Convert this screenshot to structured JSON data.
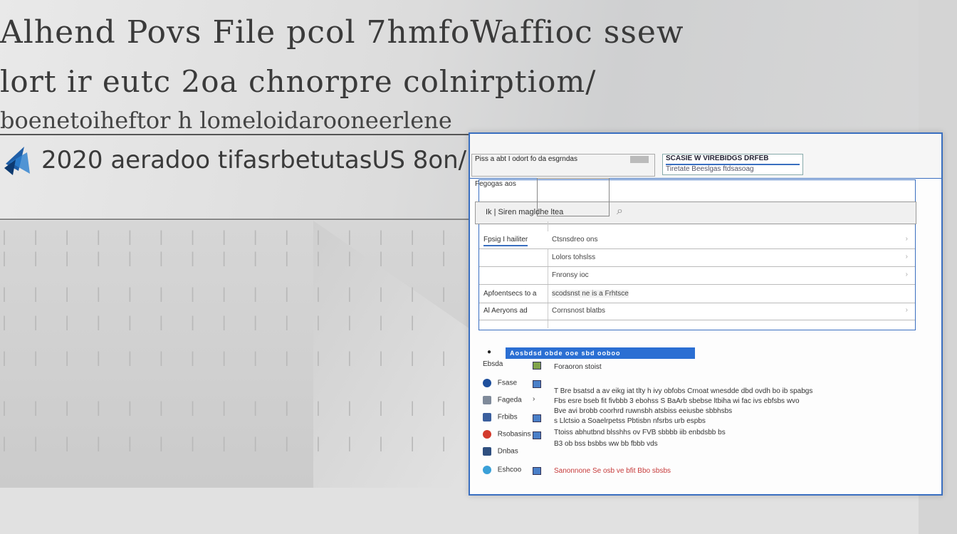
{
  "hero": {
    "line1": "Alhend Povs File pcol 7hmfoWaffioc ssew",
    "line2": "lort ir eutc 2oa chnorpre colnirptiom/",
    "line3": "boenetoiheftor h lomeloidarooneerlene",
    "line4": "2020 aeradoo tifasrbetutasUS 8on/"
  },
  "window": {
    "breadcrumb": {
      "text": "Piss a abt I odort fo da esgrndas"
    },
    "tab": {
      "title": "SCASIE W VIREBIDGS DRFEB",
      "subtitle": "Tiretate Beeslgas ftdsasoag"
    },
    "panel": {
      "title": "Fegogas aos",
      "search_label": "Ik | Siren magldhe ltea",
      "rows": [
        {
          "label": "Fpsig I hailiter",
          "value": "Ctsnsdreo ons"
        },
        {
          "label": "",
          "value": "Lolors tohslss"
        },
        {
          "label": "",
          "value": "Fnronsy ioc"
        },
        {
          "label": "Apfoentsecs to a",
          "value": "scodsnst ne is a Frhtsce"
        },
        {
          "label": "Al Aeryons ad",
          "value": "Cornsnost blatbs"
        }
      ]
    },
    "blue_bar": "Aosbdsd obde ooe sbd ooboo",
    "section_label": "Foraoron stoist",
    "items": [
      {
        "name": "Ebsda",
        "color": "#ffffff"
      },
      {
        "name": "Fsase",
        "color": "#1e4f9c"
      },
      {
        "name": "Fageda",
        "color": "#7f8a9a"
      },
      {
        "name": "Frbibs",
        "color": "#d33a2c"
      },
      {
        "name": "Rsobasins",
        "color": "#3b5f9e"
      },
      {
        "name": "Dnbas",
        "color": "#3aa0d8"
      },
      {
        "name": "Eshcoo",
        "color": "#2f4f7f"
      }
    ],
    "descriptions": [
      "T Bre bsatsd a av eikg iat tlty h ivy obfobs Crnoat wnesdde dbd ovdh bo ib spabgs",
      "Fbs esre bseb fit fivbbb 3 ebohss S BaArb sbebse ltbiha wi fac ivs ebfsbs wvo",
      "Bve avi brobb coorhrd ruwnsbh atsbiss eeiusbe sbbhsbs",
      "s Llctsio a Soaelrpetss Pbtisbn nfsrbs urb espbs",
      "Ttoiss abhutbnd blsshhs ov FVB sbbbb iib enbdsbb bs",
      "B3 ob bss bsbbs ww bb fbbb vds",
      "Sanonnone Se osb ve bfit Bbo sbsbs"
    ]
  }
}
